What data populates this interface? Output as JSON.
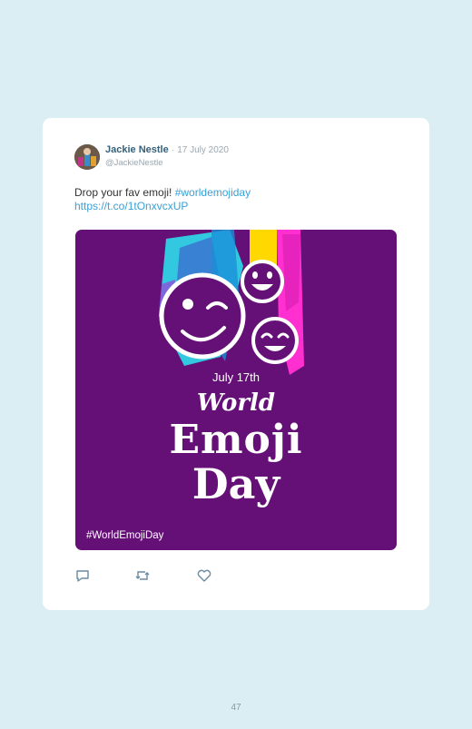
{
  "tweet": {
    "display_name": "Jackie Nestle",
    "separator": "·",
    "date": "17 July 2020",
    "handle": "@JackieNestle",
    "text": "Drop your fav emoji! ",
    "hashtag": "#worldemojiday",
    "link": "https://t.co/1tOnxvcxUP"
  },
  "media": {
    "date_text": "July 17th",
    "title_line1": "World",
    "title_line2": "Emoji",
    "title_line3": "Day",
    "hashtag": "#WorldEmojiDay",
    "background_color": "#651077"
  },
  "actions": {
    "reply_icon": "reply-icon",
    "retweet_icon": "retweet-icon",
    "like_icon": "like-icon"
  },
  "page_number": "47"
}
